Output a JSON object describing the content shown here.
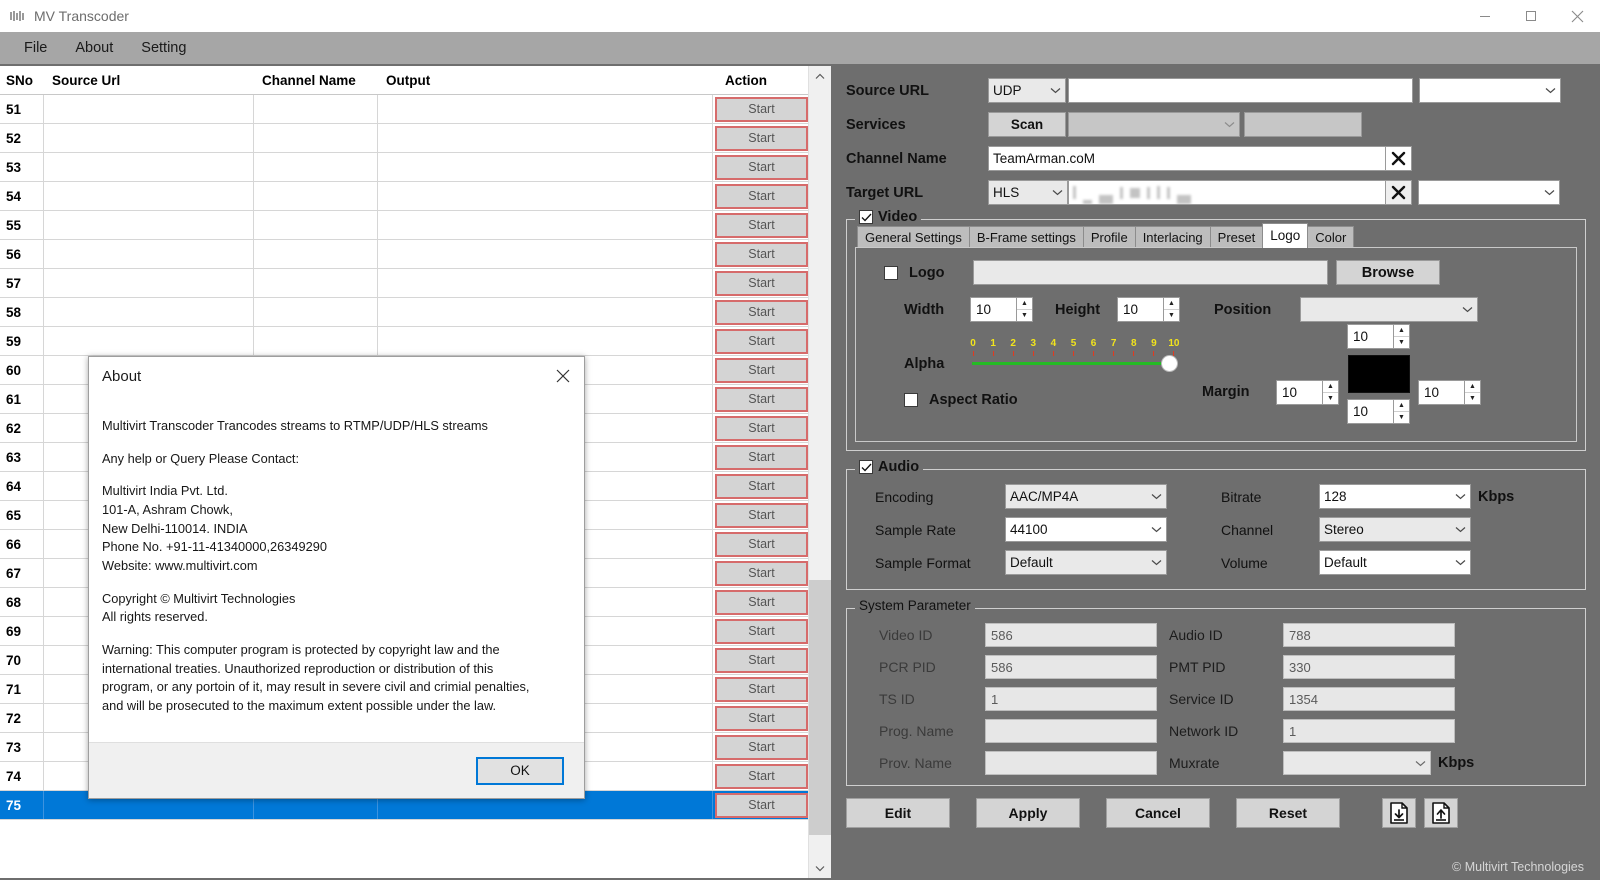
{
  "window": {
    "title": "MV Transcoder",
    "icon": "app-icon",
    "minimize": "minimize-icon",
    "maximize": "maximize-icon",
    "close": "close-icon"
  },
  "menu": {
    "items": [
      "File",
      "About",
      "Setting"
    ]
  },
  "table": {
    "columns": [
      "SNo",
      "Source Url",
      "Channel Name",
      "Output",
      "Action"
    ],
    "action_label": "Start",
    "selected_sno": 75,
    "rows": [
      {
        "sno": "51",
        "source": "",
        "channel": "",
        "output": ""
      },
      {
        "sno": "52",
        "source": "",
        "channel": "",
        "output": ""
      },
      {
        "sno": "53",
        "source": "",
        "channel": "",
        "output": ""
      },
      {
        "sno": "54",
        "source": "",
        "channel": "",
        "output": ""
      },
      {
        "sno": "55",
        "source": "",
        "channel": "",
        "output": ""
      },
      {
        "sno": "56",
        "source": "",
        "channel": "",
        "output": ""
      },
      {
        "sno": "57",
        "source": "",
        "channel": "",
        "output": ""
      },
      {
        "sno": "58",
        "source": "",
        "channel": "",
        "output": ""
      },
      {
        "sno": "59",
        "source": "",
        "channel": "",
        "output": ""
      },
      {
        "sno": "60",
        "source": "",
        "channel": "",
        "output": ""
      },
      {
        "sno": "61",
        "source": "",
        "channel": "",
        "output": ""
      },
      {
        "sno": "62",
        "source": "",
        "channel": "",
        "output": ""
      },
      {
        "sno": "63",
        "source": "",
        "channel": "",
        "output": ""
      },
      {
        "sno": "64",
        "source": "",
        "channel": "",
        "output": ""
      },
      {
        "sno": "65",
        "source": "",
        "channel": "",
        "output": ""
      },
      {
        "sno": "66",
        "source": "",
        "channel": "",
        "output": ""
      },
      {
        "sno": "67",
        "source": "",
        "channel": "",
        "output": ""
      },
      {
        "sno": "68",
        "source": "",
        "channel": "",
        "output": ""
      },
      {
        "sno": "69",
        "source": "",
        "channel": "",
        "output": ""
      },
      {
        "sno": "70",
        "source": "",
        "channel": "",
        "output": ""
      },
      {
        "sno": "71",
        "source": "",
        "channel": "",
        "output": ""
      },
      {
        "sno": "72",
        "source": "",
        "channel": "",
        "output": ""
      },
      {
        "sno": "73",
        "source": "",
        "channel": "",
        "output": ""
      },
      {
        "sno": "74",
        "source": "",
        "channel": "",
        "output": ""
      },
      {
        "sno": "75",
        "source": "",
        "channel": "",
        "output": ""
      }
    ]
  },
  "settings": {
    "source_url": {
      "label": "Source URL",
      "protocol": "UDP",
      "value": "",
      "extra_value": ""
    },
    "services": {
      "label": "Services",
      "scan_label": "Scan",
      "list_value": "",
      "second_value": ""
    },
    "channel_name": {
      "label": "Channel Name",
      "value": "TeamArman.coM",
      "clear_icon": "close-x-icon"
    },
    "target_url": {
      "label": "Target URL",
      "protocol": "HLS",
      "value": "",
      "clear_icon": "close-x-icon",
      "extra_value": ""
    },
    "video": {
      "label": "Video",
      "checked": true,
      "tabs": [
        "General Settings",
        "B-Frame settings",
        "Profile",
        "Interlacing",
        "Preset",
        "Logo",
        "Color"
      ],
      "active_tab": "Logo",
      "logo": {
        "label": "Logo",
        "checked": false,
        "path": "",
        "browse_label": "Browse",
        "width_label": "Width",
        "width": "10",
        "height_label": "Height",
        "height": "10",
        "position_label": "Position",
        "position": "",
        "alpha_label": "Alpha",
        "alpha_ticks": [
          "0",
          "1",
          "2",
          "3",
          "4",
          "5",
          "6",
          "7",
          "8",
          "9",
          "10"
        ],
        "alpha_value": "10",
        "aspect_ratio_label": "Aspect Ratio",
        "aspect_ratio_checked": false,
        "margin_label": "Margin",
        "margin_top": "10",
        "margin_left": "10",
        "margin_right": "10",
        "margin_bottom": "10",
        "color_swatch": "#000000"
      }
    },
    "audio": {
      "label": "Audio",
      "checked": true,
      "encoding_label": "Encoding",
      "encoding": "AAC/MP4A",
      "bitrate_label": "Bitrate",
      "bitrate": "128",
      "bitrate_unit": "Kbps",
      "sample_rate_label": "Sample Rate",
      "sample_rate": "44100",
      "channel_label": "Channel",
      "channel": "Stereo",
      "sample_format_label": "Sample Format",
      "sample_format": "Default",
      "volume_label": "Volume",
      "volume": "Default"
    },
    "system_parameter": {
      "label": "System Parameter",
      "video_id_label": "Video ID",
      "video_id": "586",
      "audio_id_label": "Audio ID",
      "audio_id": "788",
      "pcr_pid_label": "PCR PID",
      "pcr_pid": "586",
      "pmt_pid_label": "PMT PID",
      "pmt_pid": "330",
      "ts_id_label": "TS ID",
      "ts_id": "1",
      "service_id_label": "Service ID",
      "service_id": "1354",
      "prog_name_label": "Prog. Name",
      "prog_name": "",
      "network_id_label": "Network ID",
      "network_id": "1",
      "prov_name_label": "Prov. Name",
      "prov_name": "",
      "muxrate_label": "Muxrate",
      "muxrate": "",
      "muxrate_unit": "Kbps"
    },
    "buttons": {
      "edit": "Edit",
      "apply": "Apply",
      "cancel": "Cancel",
      "reset": "Reset",
      "import_icon": "file-download-icon",
      "export_icon": "file-upload-icon"
    },
    "footer_credit": "© Multivirt Technologies"
  },
  "about_dialog": {
    "title": "About",
    "close_icon": "close-icon",
    "line1": "Multivirt Transcoder Trancodes streams to RTMP/UDP/HLS streams",
    "line2": "Any help or Query Please Contact:",
    "address1": "Multivirt India Pvt. Ltd.",
    "address2": "101-A, Ashram Chowk,",
    "address3": "New Delhi-110014. INDIA",
    "address4": "Phone No. +91-11-41340000,26349290",
    "address5": "Website: www.multivirt.com",
    "copyright1": "Copyright © Multivirt Technologies",
    "copyright2": "All rights reserved.",
    "warning1": "Warning: This computer program is protected by copyright law and the",
    "warning2": "international treaties. Unauthorized reproduction or distribution of this",
    "warning3": "program, or any portoin of it, may result in severe civil and crimial penalties,",
    "warning4": "and will be prosecuted to the maximum extent possible under the law.",
    "ok_label": "OK"
  },
  "colors": {
    "selection": "#0078d7",
    "panel_bg": "#6e6e6e",
    "action_border": "#d66b6b",
    "alpha_tick": "#f2e41c",
    "alpha_track": "#25bb25"
  }
}
